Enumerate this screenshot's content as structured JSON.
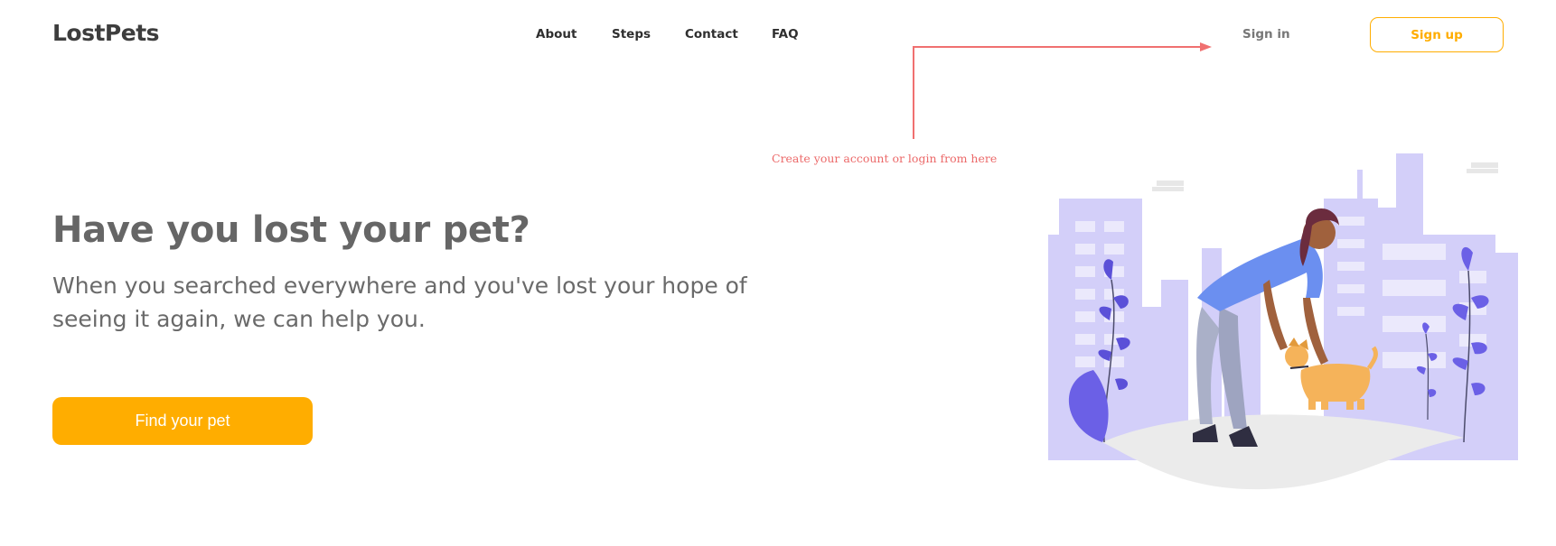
{
  "brand": {
    "logo": "LostPets"
  },
  "nav": {
    "items": [
      "About",
      "Steps",
      "Contact",
      "FAQ"
    ]
  },
  "auth": {
    "signin_label": "Sign in",
    "signup_label": "Sign up"
  },
  "annotation": {
    "text": "Create your account or login from here",
    "color": "#ec6a6a"
  },
  "hero": {
    "headline": "Have you lost your pet?",
    "subtext": "When you searched everywhere and you've lost your hope of seeing it again, we can help you.",
    "cta_label": "Find your pet"
  },
  "illustration": {
    "icon": "woman-petting-dog-city-illustration"
  },
  "colors": {
    "accent": "#ffad00",
    "building": "#d3cff9",
    "plant": "#6b60e6",
    "text": "#666666"
  }
}
